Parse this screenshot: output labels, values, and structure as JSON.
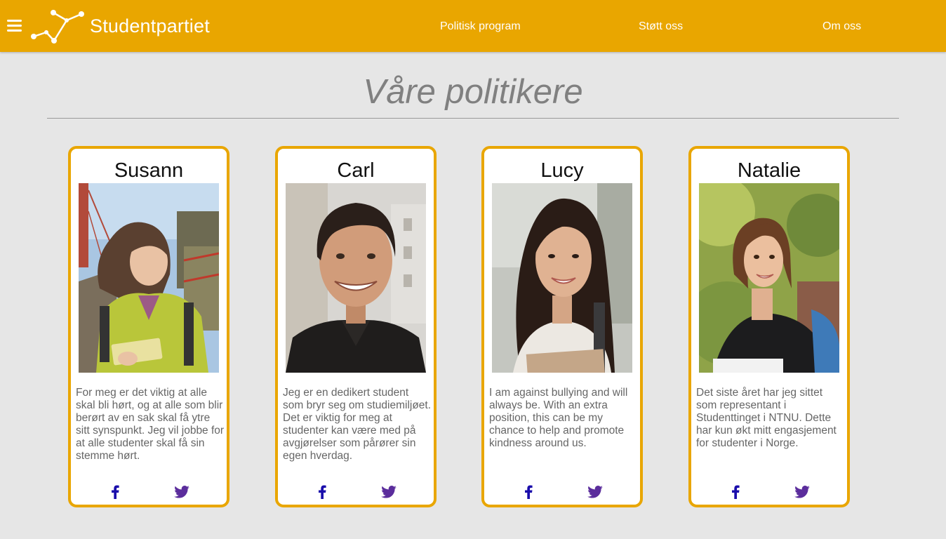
{
  "header": {
    "brand": "Studentpartiet",
    "nav": [
      {
        "label": "Politisk program"
      },
      {
        "label": "Støtt oss"
      },
      {
        "label": "Om oss"
      }
    ]
  },
  "main": {
    "title": "Våre politikere"
  },
  "politicians": [
    {
      "name": "Susann",
      "bio": "For meg er det viktig at alle skal bli hørt, og at alle som blir berørt av en sak skal få ytre sitt synspunkt. Jeg vil jobbe for at alle studenter skal få sin stemme hørt."
    },
    {
      "name": "Carl",
      "bio": "Jeg er en dedikert student som bryr seg om studiemiljøet. Det er viktig for meg at studenter kan være med på avgjørelser som pårører sin egen hverdag."
    },
    {
      "name": "Lucy",
      "bio": "I am against bullying and will always be. With an extra position, this can be my chance to help and promote kindness around us."
    },
    {
      "name": "Natalie",
      "bio": "Det siste året har jeg sittet som representant i Studenttinget i NTNU. Dette har kun økt mitt engasjement for studenter i Norge."
    }
  ],
  "icons": {
    "menu": "hamburger-menu-icon",
    "logo": "constellation-logo-icon",
    "facebook": "facebook-icon",
    "twitter": "twitter-icon"
  },
  "colors": {
    "accent": "#e9a600",
    "background": "#e6e6e6",
    "facebook": "#1a0dab",
    "twitter": "#5b2d9c"
  }
}
